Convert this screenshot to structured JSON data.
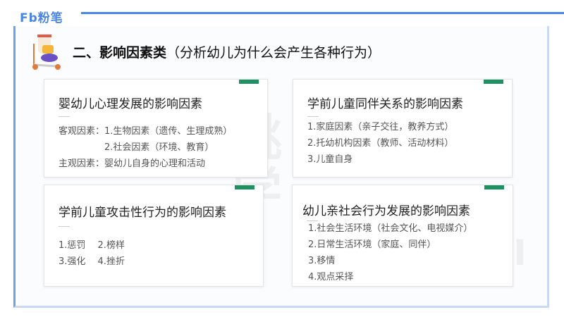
{
  "brand": {
    "logo": "Fb粉笔"
  },
  "heading": {
    "bold": "二、影响因素类",
    "sub": "（分析幼儿为什么会产生各种行为）"
  },
  "watermark": {
    "text1": "桃",
    "text2": "学",
    "text3": "BI"
  },
  "cards": [
    {
      "title": "婴幼儿心理发展的影响因素",
      "lines": [
        "客观因素：1.生物因素（遗传、生理成熟）",
        "　　　　　2.社会因素（环境、教育）",
        "主观因素：婴幼儿自身的心理和活动"
      ]
    },
    {
      "title": "学前儿童同伴关系的影响因素",
      "lines": [
        "1.家庭因素（亲子交往，教养方式）",
        "2.托幼机构因素（教师、活动材料）",
        "3.儿童自身"
      ]
    },
    {
      "title": "学前儿童攻击性行为的影响因素",
      "lines": [
        "1.惩罚　 2.榜样",
        "3.强化　 4.挫折"
      ]
    },
    {
      "title": "幼儿亲社会行为发展的影响因素",
      "lines": [
        "1.社会生活环境（社会文化、电视媒介）",
        "2.日常生活环境（家庭、同伴）",
        "3.移情",
        "4.观点采择"
      ]
    }
  ]
}
